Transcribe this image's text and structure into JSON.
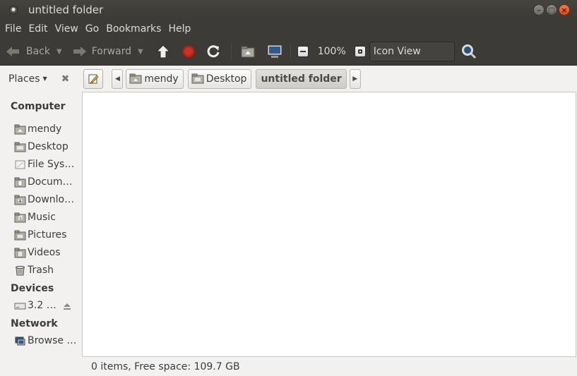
{
  "window": {
    "title": "untitled folder"
  },
  "menu": [
    "File",
    "Edit",
    "View",
    "Go",
    "Bookmarks",
    "Help"
  ],
  "toolbar": {
    "back_label": "Back",
    "forward_label": "Forward",
    "zoom_level": "100%",
    "view_mode": "Icon View"
  },
  "location": {
    "places_label": "Places",
    "crumbs": [
      "mendy",
      "Desktop",
      "untitled folder"
    ]
  },
  "sidebar": {
    "computer_heading": "Computer",
    "computer_items": [
      "mendy",
      "Desktop",
      "File Sys…",
      "Docum…",
      "Downlo…",
      "Music",
      "Pictures",
      "Videos",
      "Trash"
    ],
    "devices_heading": "Devices",
    "device_items": [
      "3.2 …"
    ],
    "network_heading": "Network",
    "network_items": [
      "Browse …"
    ]
  },
  "status": {
    "text": "0 items, Free space: 109.7 GB"
  }
}
